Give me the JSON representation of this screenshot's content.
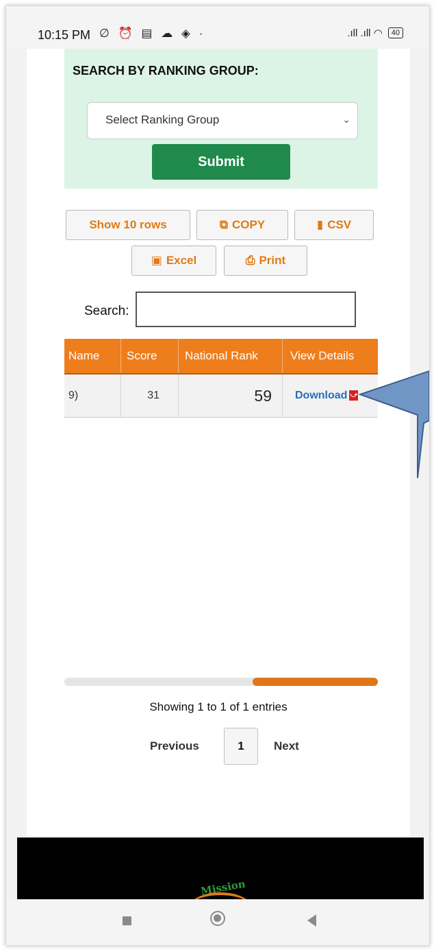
{
  "status_bar": {
    "time": "10:15 PM",
    "icons": "∅ ⏰ ▤ ☁ ◈ ·",
    "signal": ".ıll .ıll ◠",
    "battery": "40"
  },
  "search_panel": {
    "title": "SEARCH BY RANKING GROUP:",
    "select_value": "Select Ranking Group",
    "submit_label": "Submit"
  },
  "toolbar": {
    "show_rows": "Show 10 rows",
    "copy": "COPY",
    "csv": "CSV",
    "excel": "Excel",
    "print": "Print"
  },
  "search": {
    "label": "Search:",
    "value": ""
  },
  "table": {
    "headers": [
      "Name",
      "Score",
      "National Rank",
      "View Details"
    ],
    "rows": [
      {
        "name": "9)",
        "score": "31",
        "rank": "59",
        "details": "Download"
      }
    ]
  },
  "pagination": {
    "info": "Showing 1 to 1 of 1 entries",
    "previous": "Previous",
    "page": "1",
    "next": "Next",
    "scroll_position_fraction": 0.6
  },
  "footer": {
    "logo_text": "Mission"
  },
  "colors": {
    "accent_orange": "#ee7d1c",
    "submit_green": "#1f8a4c",
    "panel_green": "#dcf4e6",
    "callout_blue": "#7096c6"
  }
}
